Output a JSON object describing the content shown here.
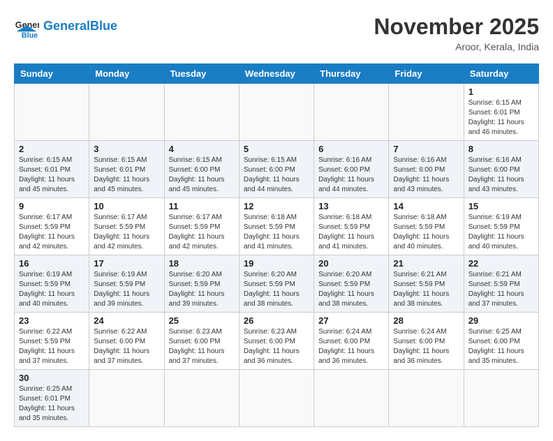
{
  "header": {
    "logo_general": "General",
    "logo_blue": "Blue",
    "month_title": "November 2025",
    "location": "Aroor, Kerala, India"
  },
  "days_of_week": [
    "Sunday",
    "Monday",
    "Tuesday",
    "Wednesday",
    "Thursday",
    "Friday",
    "Saturday"
  ],
  "weeks": [
    [
      {
        "day": "",
        "info": ""
      },
      {
        "day": "",
        "info": ""
      },
      {
        "day": "",
        "info": ""
      },
      {
        "day": "",
        "info": ""
      },
      {
        "day": "",
        "info": ""
      },
      {
        "day": "",
        "info": ""
      },
      {
        "day": "1",
        "info": "Sunrise: 6:15 AM\nSunset: 6:01 PM\nDaylight: 11 hours\nand 46 minutes."
      }
    ],
    [
      {
        "day": "2",
        "info": "Sunrise: 6:15 AM\nSunset: 6:01 PM\nDaylight: 11 hours\nand 45 minutes."
      },
      {
        "day": "3",
        "info": "Sunrise: 6:15 AM\nSunset: 6:01 PM\nDaylight: 11 hours\nand 45 minutes."
      },
      {
        "day": "4",
        "info": "Sunrise: 6:15 AM\nSunset: 6:00 PM\nDaylight: 11 hours\nand 45 minutes."
      },
      {
        "day": "5",
        "info": "Sunrise: 6:15 AM\nSunset: 6:00 PM\nDaylight: 11 hours\nand 44 minutes."
      },
      {
        "day": "6",
        "info": "Sunrise: 6:16 AM\nSunset: 6:00 PM\nDaylight: 11 hours\nand 44 minutes."
      },
      {
        "day": "7",
        "info": "Sunrise: 6:16 AM\nSunset: 6:00 PM\nDaylight: 11 hours\nand 43 minutes."
      },
      {
        "day": "8",
        "info": "Sunrise: 6:16 AM\nSunset: 6:00 PM\nDaylight: 11 hours\nand 43 minutes."
      }
    ],
    [
      {
        "day": "9",
        "info": "Sunrise: 6:17 AM\nSunset: 5:59 PM\nDaylight: 11 hours\nand 42 minutes."
      },
      {
        "day": "10",
        "info": "Sunrise: 6:17 AM\nSunset: 5:59 PM\nDaylight: 11 hours\nand 42 minutes."
      },
      {
        "day": "11",
        "info": "Sunrise: 6:17 AM\nSunset: 5:59 PM\nDaylight: 11 hours\nand 42 minutes."
      },
      {
        "day": "12",
        "info": "Sunrise: 6:18 AM\nSunset: 5:59 PM\nDaylight: 11 hours\nand 41 minutes."
      },
      {
        "day": "13",
        "info": "Sunrise: 6:18 AM\nSunset: 5:59 PM\nDaylight: 11 hours\nand 41 minutes."
      },
      {
        "day": "14",
        "info": "Sunrise: 6:18 AM\nSunset: 5:59 PM\nDaylight: 11 hours\nand 40 minutes."
      },
      {
        "day": "15",
        "info": "Sunrise: 6:19 AM\nSunset: 5:59 PM\nDaylight: 11 hours\nand 40 minutes."
      }
    ],
    [
      {
        "day": "16",
        "info": "Sunrise: 6:19 AM\nSunset: 5:59 PM\nDaylight: 11 hours\nand 40 minutes."
      },
      {
        "day": "17",
        "info": "Sunrise: 6:19 AM\nSunset: 5:59 PM\nDaylight: 11 hours\nand 39 minutes."
      },
      {
        "day": "18",
        "info": "Sunrise: 6:20 AM\nSunset: 5:59 PM\nDaylight: 11 hours\nand 39 minutes."
      },
      {
        "day": "19",
        "info": "Sunrise: 6:20 AM\nSunset: 5:59 PM\nDaylight: 11 hours\nand 38 minutes."
      },
      {
        "day": "20",
        "info": "Sunrise: 6:20 AM\nSunset: 5:59 PM\nDaylight: 11 hours\nand 38 minutes."
      },
      {
        "day": "21",
        "info": "Sunrise: 6:21 AM\nSunset: 5:59 PM\nDaylight: 11 hours\nand 38 minutes."
      },
      {
        "day": "22",
        "info": "Sunrise: 6:21 AM\nSunset: 5:59 PM\nDaylight: 11 hours\nand 37 minutes."
      }
    ],
    [
      {
        "day": "23",
        "info": "Sunrise: 6:22 AM\nSunset: 5:59 PM\nDaylight: 11 hours\nand 37 minutes."
      },
      {
        "day": "24",
        "info": "Sunrise: 6:22 AM\nSunset: 6:00 PM\nDaylight: 11 hours\nand 37 minutes."
      },
      {
        "day": "25",
        "info": "Sunrise: 6:23 AM\nSunset: 6:00 PM\nDaylight: 11 hours\nand 37 minutes."
      },
      {
        "day": "26",
        "info": "Sunrise: 6:23 AM\nSunset: 6:00 PM\nDaylight: 11 hours\nand 36 minutes."
      },
      {
        "day": "27",
        "info": "Sunrise: 6:24 AM\nSunset: 6:00 PM\nDaylight: 11 hours\nand 36 minutes."
      },
      {
        "day": "28",
        "info": "Sunrise: 6:24 AM\nSunset: 6:00 PM\nDaylight: 11 hours\nand 36 minutes."
      },
      {
        "day": "29",
        "info": "Sunrise: 6:25 AM\nSunset: 6:00 PM\nDaylight: 11 hours\nand 35 minutes."
      }
    ],
    [
      {
        "day": "30",
        "info": "Sunrise: 6:25 AM\nSunset: 6:01 PM\nDaylight: 11 hours\nand 35 minutes."
      },
      {
        "day": "",
        "info": ""
      },
      {
        "day": "",
        "info": ""
      },
      {
        "day": "",
        "info": ""
      },
      {
        "day": "",
        "info": ""
      },
      {
        "day": "",
        "info": ""
      },
      {
        "day": "",
        "info": ""
      }
    ]
  ]
}
